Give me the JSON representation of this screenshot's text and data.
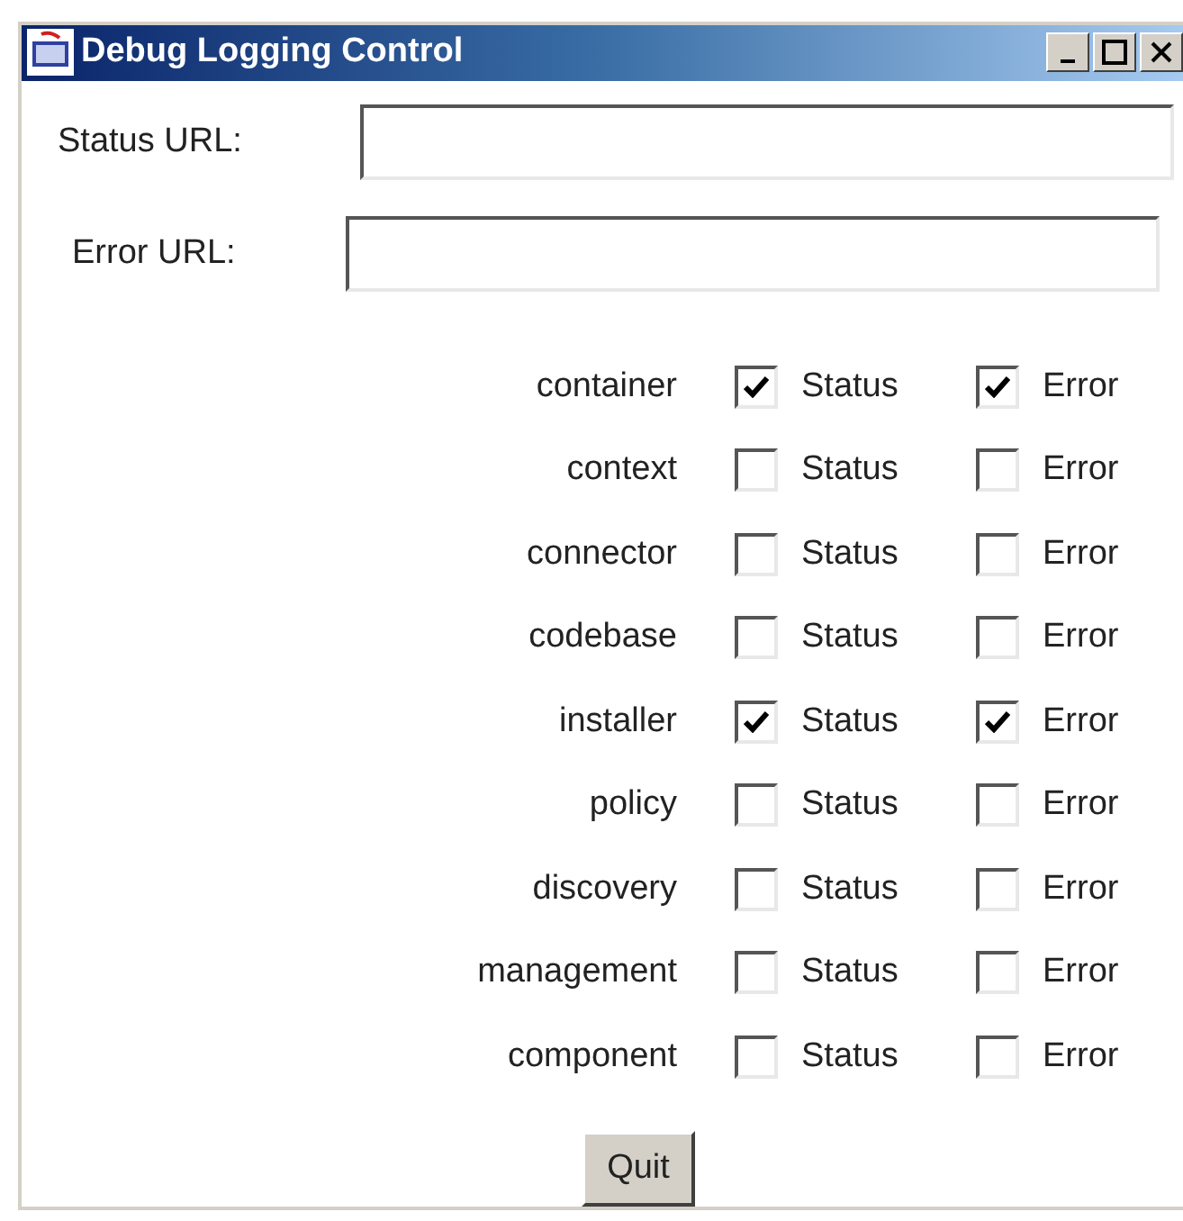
{
  "window": {
    "title": "Debug Logging Control"
  },
  "fields": [
    {
      "label": "Status URL:"
    },
    {
      "label": "Error URL:"
    }
  ],
  "categories": [
    {
      "name": "container",
      "status": {
        "label": "Status",
        "checked": true
      },
      "error": {
        "label": "Error",
        "checked": true
      }
    },
    {
      "name": "context",
      "status": {
        "label": "Status",
        "checked": false
      },
      "error": {
        "label": "Error",
        "checked": false
      }
    },
    {
      "name": "connector",
      "status": {
        "label": "Status",
        "checked": false
      },
      "error": {
        "label": "Error",
        "checked": false
      }
    },
    {
      "name": "codebase",
      "status": {
        "label": "Status",
        "checked": false
      },
      "error": {
        "label": "Error",
        "checked": false
      }
    },
    {
      "name": "installer",
      "status": {
        "label": "Status",
        "checked": true
      },
      "error": {
        "label": "Error",
        "checked": true
      }
    },
    {
      "name": "policy",
      "status": {
        "label": "Status",
        "checked": false
      },
      "error": {
        "label": "Error",
        "checked": false
      }
    },
    {
      "name": "discovery",
      "status": {
        "label": "Status",
        "checked": false
      },
      "error": {
        "label": "Error",
        "checked": false
      }
    },
    {
      "name": "management",
      "status": {
        "label": "Status",
        "checked": false
      },
      "error": {
        "label": "Error",
        "checked": false
      }
    },
    {
      "name": "component",
      "status": {
        "label": "Status",
        "checked": false
      },
      "error": {
        "label": "Error",
        "checked": false
      }
    }
  ],
  "buttons": [
    {
      "label": "Quit"
    }
  ]
}
